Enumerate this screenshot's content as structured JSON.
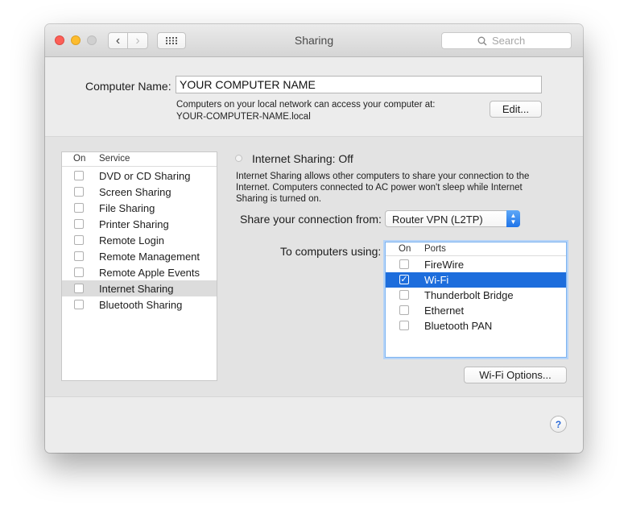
{
  "window": {
    "title": "Sharing",
    "search_placeholder": "Search"
  },
  "computer_name": {
    "label": "Computer Name:",
    "value": "YOUR COMPUTER NAME",
    "note_line1": "Computers on your local network can access your computer at:",
    "note_line2": "YOUR-COMPUTER-NAME.local",
    "edit_label": "Edit..."
  },
  "services": {
    "header_on": "On",
    "header_service": "Service",
    "items": [
      {
        "label": "DVD or CD Sharing",
        "checked": false
      },
      {
        "label": "Screen Sharing",
        "checked": false
      },
      {
        "label": "File Sharing",
        "checked": false
      },
      {
        "label": "Printer Sharing",
        "checked": false
      },
      {
        "label": "Remote Login",
        "checked": false
      },
      {
        "label": "Remote Management",
        "checked": false
      },
      {
        "label": "Remote Apple Events",
        "checked": false
      },
      {
        "label": "Internet Sharing",
        "checked": false,
        "selected": true
      },
      {
        "label": "Bluetooth Sharing",
        "checked": false
      }
    ]
  },
  "internet_sharing": {
    "status": "Internet Sharing: Off",
    "description": "Internet Sharing allows other computers to share your connection to the Internet. Computers connected to AC power won't sleep while Internet Sharing is turned on.",
    "share_from_label": "Share your connection from:",
    "share_from_value": "Router VPN (L2TP)",
    "to_computers_label": "To computers using:",
    "ports_header_on": "On",
    "ports_header_ports": "Ports",
    "ports": [
      {
        "label": "FireWire",
        "checked": false
      },
      {
        "label": "Wi-Fi",
        "checked": true,
        "selected": true
      },
      {
        "label": "Thunderbolt Bridge",
        "checked": false
      },
      {
        "label": "Ethernet",
        "checked": false
      },
      {
        "label": "Bluetooth PAN",
        "checked": false
      }
    ],
    "wifi_options_label": "Wi-Fi Options..."
  },
  "help": {
    "label": "?"
  },
  "colors": {
    "selection_blue": "#1d6ddc",
    "close": "#fc5f57",
    "minimize": "#fdbc2e"
  }
}
